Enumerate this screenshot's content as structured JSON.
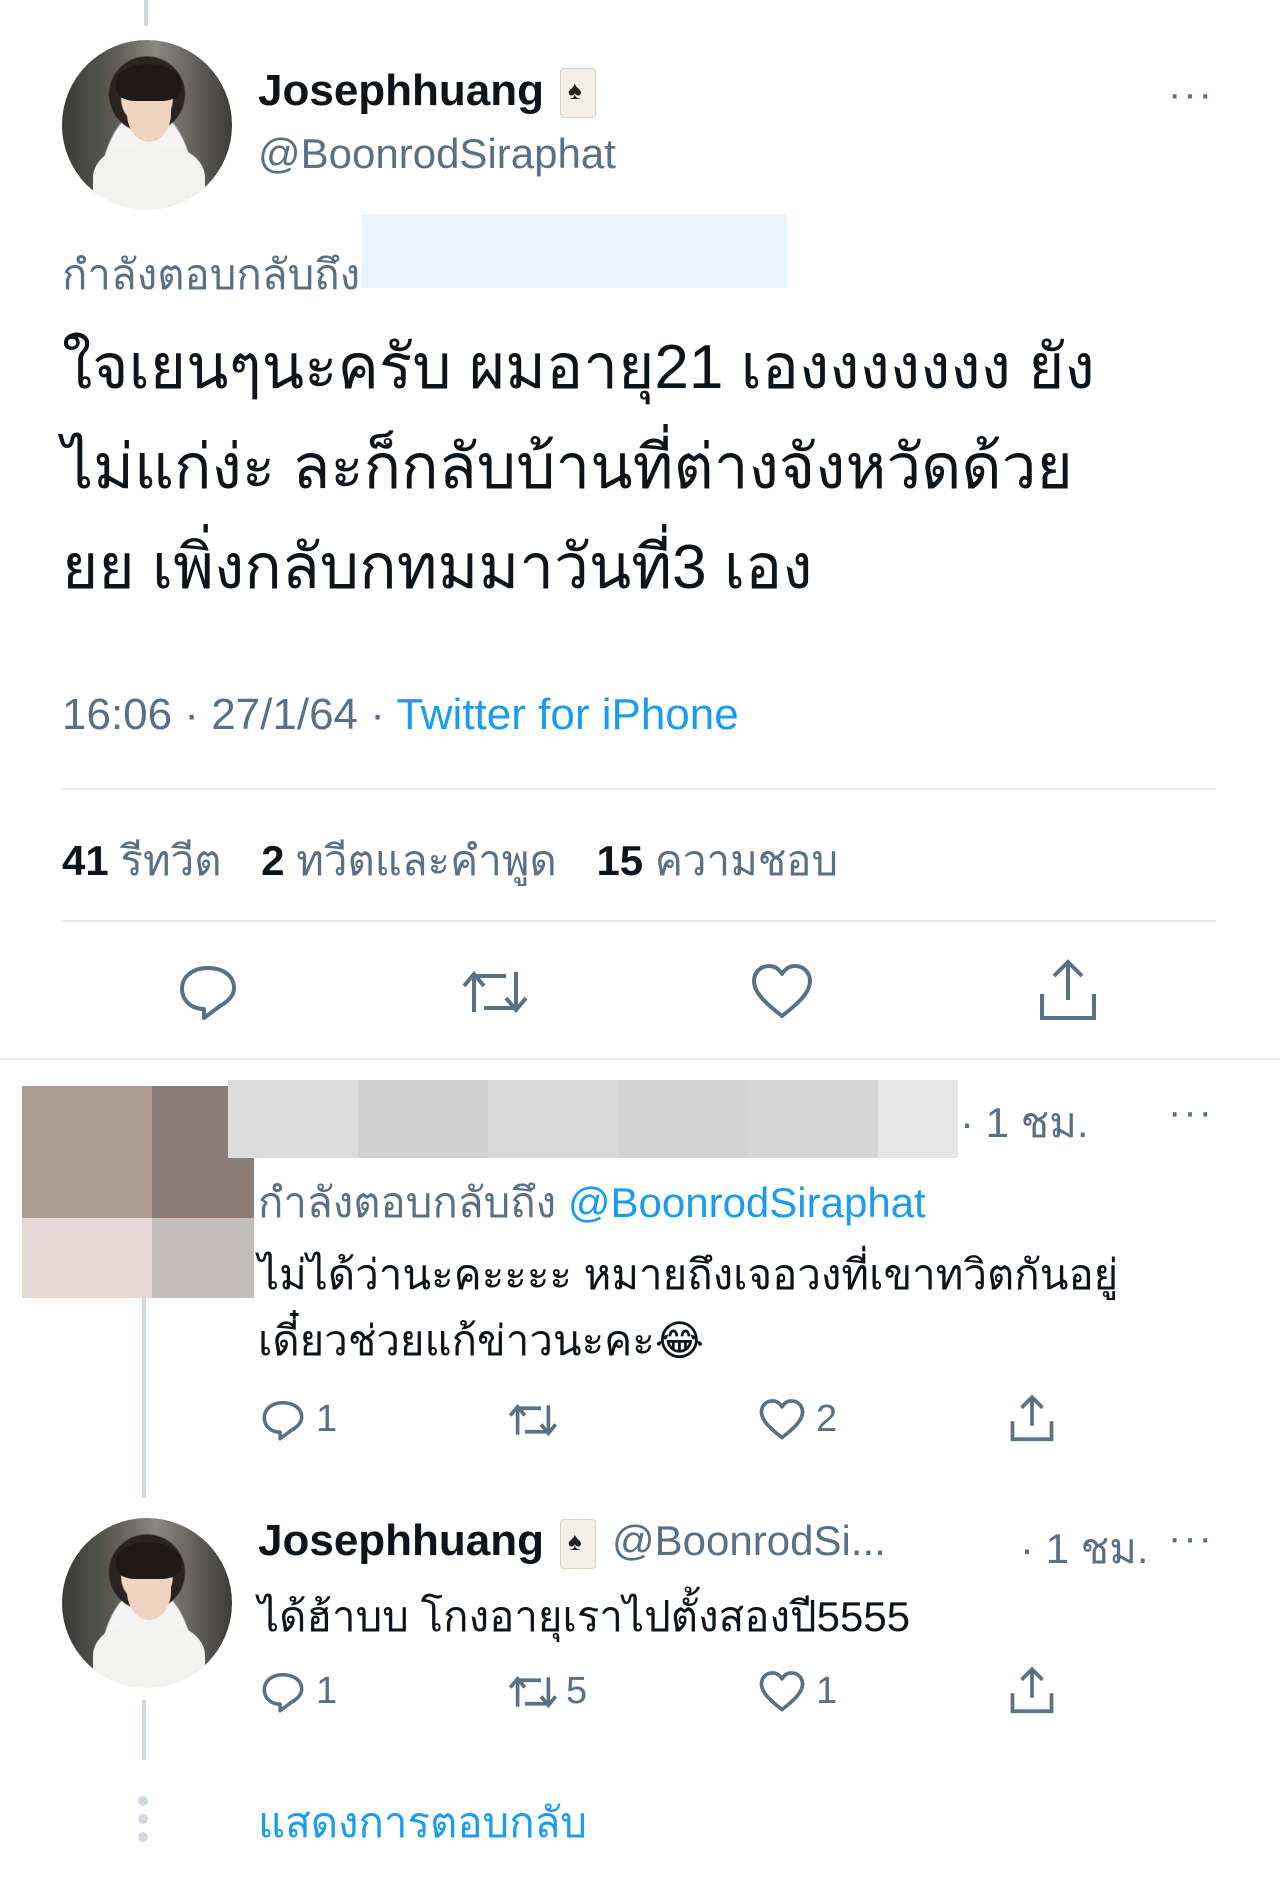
{
  "main_tweet": {
    "display_name": "Josephhuang",
    "handle": "@BoonrodSiraphat",
    "reply_to_label": "กำลังตอบกลับถึง",
    "text_line1": "ใจเยนๆนะครับ ผมอายุ21 เองงงงงงง ยัง",
    "text_line2": "ไม่แก่ง่ะ ละก็กลับบ้านที่ต่างจังหวัดด้วย",
    "text_line3": "ยย เพิ่งกลับกทมมาวันที่3 เอง",
    "time": "16:06 · 27/1/64 · ",
    "source": "Twitter for iPhone",
    "stats": {
      "retweets_count": "41",
      "retweets_label": "รีทวีต",
      "quotes_count": "2",
      "quotes_label": "ทวีตและคำพูด",
      "likes_count": "15",
      "likes_label": "ความชอบ"
    }
  },
  "reply1": {
    "time": "· 1 ชม.",
    "reply_to_label": "กำลังตอบกลับถึง",
    "reply_to_handle": "@BoonrodSiraphat",
    "text_line1": "ไม่ได้ว่านะคะะะะ หมายถึงเจอวงที่เขาทวิตกันอยู่",
    "text_line2": "เดี๋ยวช่วยแก้ข่าวนะคะ😂",
    "reply_count": "1",
    "retweet_count": "",
    "like_count": "2"
  },
  "reply2": {
    "display_name": "Josephhuang",
    "handle": "@BoonrodSi...",
    "time": "· 1 ชม.",
    "text": "ได้ฮ้าบบ โกงอายุเราไปตั้งสองปี5555",
    "reply_count": "1",
    "retweet_count": "5",
    "like_count": "1"
  },
  "show_replies": "แสดงการตอบกลับ",
  "more_glyph": "···",
  "colors": {
    "link": "#1d9bf0",
    "muted": "#5b7083",
    "divider": "#e6ecf0"
  }
}
